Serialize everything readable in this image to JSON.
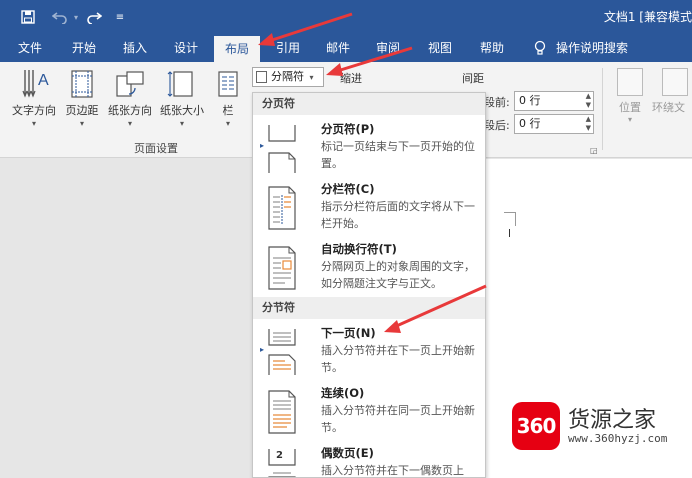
{
  "window": {
    "title": "文档1 [兼容模式"
  },
  "quick_access": {
    "save_icon": "save-icon",
    "undo_icon": "undo-icon",
    "redo_icon": "redo-icon",
    "customize_icon": "customize-qat-icon"
  },
  "tabs": [
    {
      "label": "文件"
    },
    {
      "label": "开始"
    },
    {
      "label": "插入"
    },
    {
      "label": "设计"
    },
    {
      "label": "布局",
      "active": true
    },
    {
      "label": "引用"
    },
    {
      "label": "邮件"
    },
    {
      "label": "审阅"
    },
    {
      "label": "视图"
    },
    {
      "label": "帮助"
    }
  ],
  "tell_me": {
    "label": "操作说明搜索",
    "icon": "lightbulb-icon"
  },
  "ribbon": {
    "page_setup": {
      "label": "页面设置",
      "buttons": [
        {
          "label": "文字方向",
          "icon": "text-direction-icon"
        },
        {
          "label": "页边距",
          "icon": "margins-icon"
        },
        {
          "label": "纸张方向",
          "icon": "orientation-icon"
        },
        {
          "label": "纸张大小",
          "icon": "paper-size-icon"
        },
        {
          "label": "栏",
          "icon": "columns-icon"
        }
      ]
    },
    "breaks_button": {
      "label": "分隔符"
    },
    "indent_label": "缩进",
    "spacing": {
      "label": "间距",
      "before_label": "段前:",
      "before_value": "0 行",
      "after_label": "段后:",
      "after_value": "0 行"
    },
    "arrange": {
      "position_label": "位置",
      "wrap_label": "环绕文"
    }
  },
  "breaks_menu": {
    "page_breaks_header": "分页符",
    "section_breaks_header": "分节符",
    "items": [
      {
        "title": "分页符(P)",
        "desc": "标记一页结束与下一页开始的位置。",
        "icon": "page-break-icon"
      },
      {
        "title": "分栏符(C)",
        "desc": "指示分栏符后面的文字将从下一栏开始。",
        "icon": "column-break-icon"
      },
      {
        "title": "自动换行符(T)",
        "desc": "分隔网页上的对象周围的文字，如分隔题注文字与正文。",
        "icon": "text-wrapping-break-icon"
      },
      {
        "title": "下一页(N)",
        "desc": "插入分节符并在下一页上开始新节。",
        "icon": "next-page-icon"
      },
      {
        "title": "连续(O)",
        "desc": "插入分节符并在同一页上开始新节。",
        "icon": "continuous-icon"
      },
      {
        "title": "偶数页(E)",
        "desc": "插入分节符并在下一偶数页上",
        "icon": "even-page-icon",
        "icon_text": "2"
      }
    ]
  },
  "watermark": {
    "logo": "360",
    "name": "货源之家",
    "url": "www.360hyzj.com"
  },
  "colors": {
    "accent": "#2b579a",
    "arrow": "#e8393a",
    "logo_red": "#e60012"
  }
}
